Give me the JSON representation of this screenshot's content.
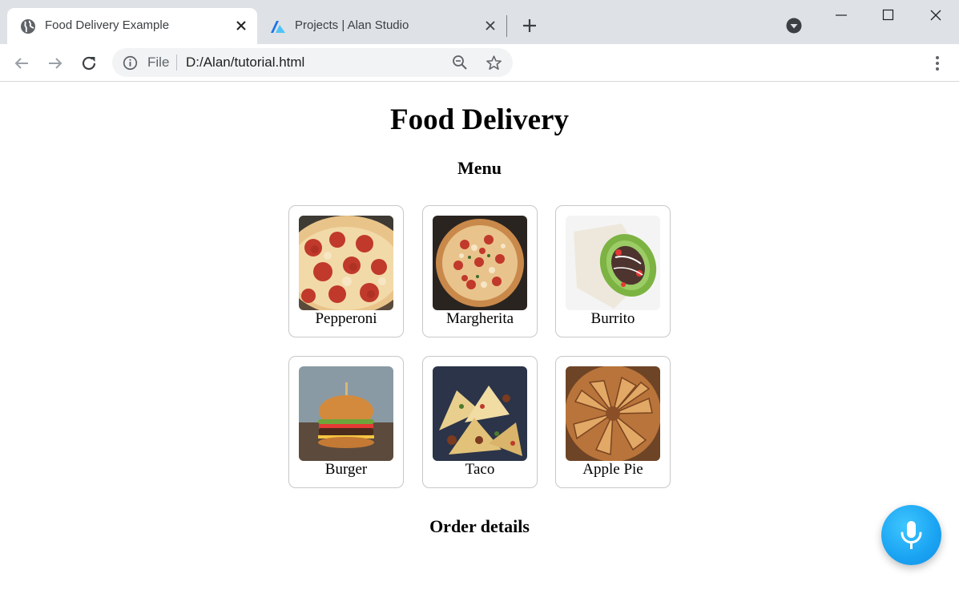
{
  "browser": {
    "tabs": [
      {
        "title": "Food Delivery Example",
        "icon": "globe-icon",
        "active": true
      },
      {
        "title": "Projects | Alan Studio",
        "icon": "alan-logo-icon",
        "active": false
      }
    ],
    "address_bar": {
      "scheme_label": "File",
      "url": "D:/Alan/tutorial.html"
    }
  },
  "page": {
    "title": "Food Delivery",
    "menu_heading": "Menu",
    "menu_items": [
      {
        "name": "Pepperoni"
      },
      {
        "name": "Margherita"
      },
      {
        "name": "Burrito"
      },
      {
        "name": "Burger"
      },
      {
        "name": "Taco"
      },
      {
        "name": "Apple Pie"
      }
    ],
    "order_heading": "Order details"
  },
  "colors": {
    "tabstrip_bg": "#dee1e6",
    "omnibox_bg": "#f1f3f4",
    "mic_button": "#1aa3f2"
  }
}
